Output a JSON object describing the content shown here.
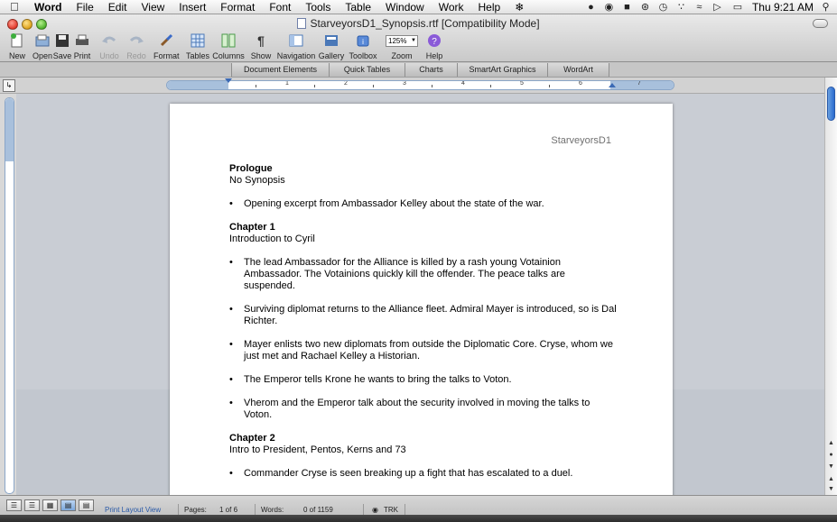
{
  "menubar": {
    "app": "Word",
    "items": [
      "File",
      "Edit",
      "View",
      "Insert",
      "Format",
      "Font",
      "Tools",
      "Table",
      "Window",
      "Work",
      "Help"
    ],
    "clock": "Thu 9:21 AM"
  },
  "window": {
    "title": "StarveyorsD1_Synopsis.rtf [Compatibility Mode]"
  },
  "toolbar": {
    "new": "New",
    "open": "Open",
    "save": "Save",
    "print": "Print",
    "undo": "Undo",
    "redo": "Redo",
    "format": "Format",
    "tables": "Tables",
    "columns": "Columns",
    "show": "Show",
    "navigation": "Navigation",
    "gallery": "Gallery",
    "toolbox": "Toolbox",
    "zoom": "Zoom",
    "help": "Help",
    "zoom_value": "125%"
  },
  "ribbon": {
    "tabs": [
      "Document Elements",
      "Quick Tables",
      "Charts",
      "SmartArt Graphics",
      "WordArt"
    ]
  },
  "ruler": {
    "numbers": [
      "1",
      "2",
      "3",
      "4",
      "5",
      "6",
      "7"
    ]
  },
  "document": {
    "header": "StarveyorsD1",
    "sections": [
      {
        "heading": "Prologue",
        "subtitle": "No Synopsis",
        "bullets": [
          "Opening excerpt from Ambassador Kelley about the state of the war."
        ]
      },
      {
        "heading": "Chapter 1",
        "subtitle": "Introduction to Cyril",
        "bullets": [
          "The lead Ambassador for the Alliance is killed by a rash young Votainion Ambassador. The Votainions quickly kill the offender. The peace talks are suspended.",
          "Surviving diplomat returns to the Alliance fleet. Admiral Mayer is introduced, so is Dal Richter.",
          "Mayer enlists two new diplomats from outside the Diplomatic Core. Cryse, whom we just met and Rachael Kelley a Historian.",
          "The Emperor tells Krone he wants to bring the talks to Voton.",
          "Vherom and the Emperor talk about the security involved in moving the talks to Voton."
        ]
      },
      {
        "heading": "Chapter 2",
        "subtitle": "Intro to President, Pentos, Kerns and 73",
        "bullets": [
          "Commander Cryse is seen breaking up a fight that has escalated to a duel."
        ]
      }
    ]
  },
  "status": {
    "view": "Print Layout View",
    "pages_label": "Pages:",
    "pages_value": "1 of 6",
    "words_label": "Words:",
    "words_value": "0 of 1159",
    "trk": "TRK"
  }
}
